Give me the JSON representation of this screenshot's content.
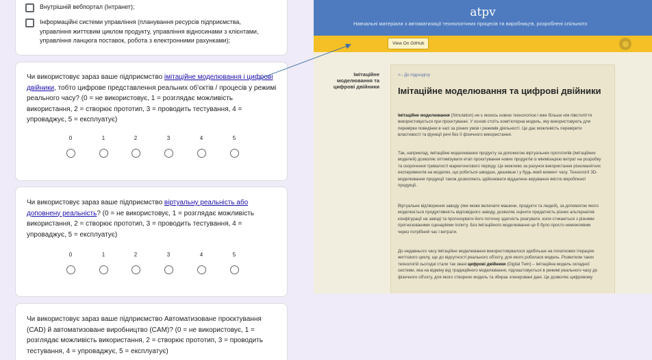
{
  "form": {
    "options": [
      "Внутрішній вебпортал (Інтранет);",
      "Інформаційні системи управління (планування ресурсів підприємства, управління життєвим циклом продукту, управління відносинами з клієнтами, управління ланцюга поставок, робота з електронними рахунками);"
    ],
    "questions": [
      {
        "prefix": "Чи використовує зараз ваше підприємство ",
        "link": "імітаційне моделювання і цифрові двійники",
        "suffix": ", тобто цифрове представлення реальних об'єктів / процесів у режимі реального часу? (0 = не використовує, 1 = розглядає можливість використання, 2 = створює прототип, 3 = проводить тестування, 4 = упроваджує, 5 = експлуатує)",
        "scale": [
          "0",
          "1",
          "2",
          "3",
          "4",
          "5"
        ]
      },
      {
        "prefix": "Чи використовує зараз ваше підприємство ",
        "link": "віртуальну реальність або доповнену реальність",
        "suffix": "? (0 = не використовує, 1 = розглядає можливість використання, 2 = створює прототип, 3 = проводить тестування, 4 = упроваджує, 5 = експлуатує)",
        "scale": [
          "0",
          "1",
          "2",
          "3",
          "4",
          "5"
        ]
      },
      {
        "text": "Чи використовує зараз ваше підприємство Автоматизоване проєктування (CAD) й автоматизоване виробництво (CAM)? (0 = не використовує, 1 = розглядає можливість використання, 2 = створює прототип, 3 = проводить тестування, 4 = упроваджує, 5 = експлуатує)"
      }
    ]
  },
  "preview": {
    "logo": "atpv",
    "tagline": "Навчальні матеріали з автоматизації технологічних процесів та виробництв, розроблені спільното",
    "github_button": "View On GitHub",
    "side_title": "Імітаційне моделювання та цифрові двійники",
    "breadcrumb": "<-- До підрозділу",
    "title": "Імітаційне моделювання та цифрові двійники",
    "para1_bold": "Імітаційне моделювання",
    "para1_rest": " (Simulation) не є якоюсь новою технологією і вже більше ніж півстоліття використовується при проєктуванні. У основі стоїть комп'ютерна модель, яку використовують для перевірки поведінки в часі за різних умов і режимів діяльності. Це дає можливість перевірити властивості та функції речі без її фізичного використання.",
    "para2": "Так, наприклад, імітаційне моделювання продукту за допомогою віртуальних прототипів (імітаційних моделей) дозволяє оптимізувати етап проєктування нових продуктів із мінімізацією витрат на розробку та скорочення тривалості маркетингового періоду. Це можливо за рахунок використання різноманітних експериментів на моделях, що робиться швидше, дешевше і у будь який момент часу. Технології 3D-моделювання продукції також дозволяють здійснювати віддалене керування якістю виробленої продукції.",
    "para3": "Віртуальне відтворення заводу (яке може включати машини, продукти та людей), за допомогою якого моделюється продуктивність відповідного заводу, дозволяє оцінити придатність різних альтернатив конфігурації на заводі та прогнозувати його поточну здатність реагувати, коли стикаються з різними прогнозованими сценаріями попиту. Без імітаційного моделювання це б було просто неможливим через потрібний час і витрати.",
    "para4_a": "До недавнього часу імітаційне моделювання використовувалося здебільше на початкових ітераціях життєвого циклу, ще до відсутності реального об'єкту, для якого робилася модель. Розвитком таких технологій сьогодні стали так звані ",
    "para4_bold": "цифрові двійники",
    "para4_b": " (Digital Twin) – імітаційна модель складної системи, яка на відміну від традиційного моделювання, підлаштовується в режимі реального часу до фізичного об'єкту, для якого створено модель та збирає згенеровані дані. Це дозволяє цифровому"
  },
  "colors": {
    "header_blue": "#4e7bbf",
    "bar_yellow": "#f4c025",
    "link_blue": "#1a0dab",
    "form_background": "#f0ebf8"
  }
}
